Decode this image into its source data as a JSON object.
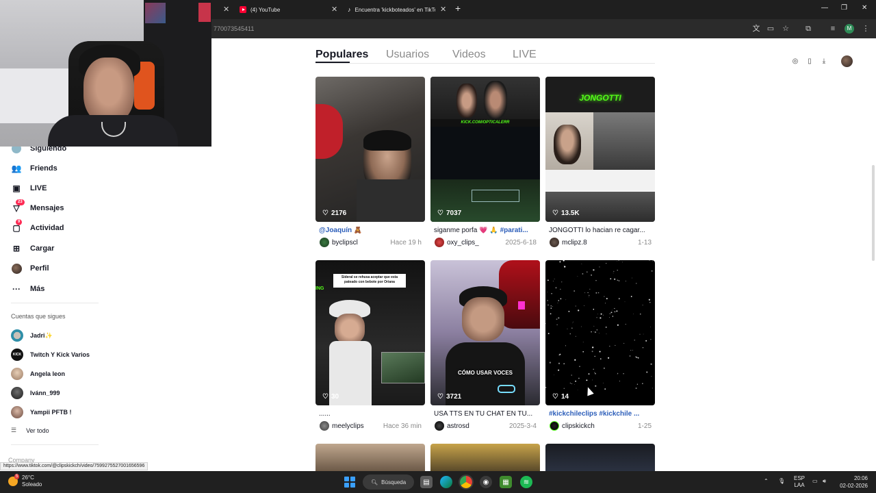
{
  "browser": {
    "tabs": [
      {
        "title": "(4) YouTube",
        "icon": "youtube-icon"
      },
      {
        "title": "Encuentra 'kickboteados' en TikTok",
        "icon": "tiktok-icon"
      }
    ],
    "url": "770073545411",
    "profile_initial": "M"
  },
  "search_tabs": [
    "Populares",
    "Usuarios",
    "Videos",
    "LIVE"
  ],
  "active_tab": "Populares",
  "sidebar": {
    "items": [
      {
        "label": "Siguiendo",
        "icon": "following-icon"
      },
      {
        "label": "Friends",
        "icon": "friends-icon"
      },
      {
        "label": "LIVE",
        "icon": "live-icon"
      },
      {
        "label": "Mensajes",
        "icon": "messages-icon",
        "badge": "23"
      },
      {
        "label": "Actividad",
        "icon": "activity-icon",
        "badge": "9"
      },
      {
        "label": "Cargar",
        "icon": "upload-icon"
      },
      {
        "label": "Perfil",
        "icon": "profile-icon"
      },
      {
        "label": "Más",
        "icon": "more-icon"
      }
    ],
    "following_header": "Cuentas que sigues",
    "following": [
      {
        "name": "Jadri✨"
      },
      {
        "name": "Twitch Y Kick Varios"
      },
      {
        "name": "Angela leon"
      },
      {
        "name": "Ivánn_999"
      },
      {
        "name": "Yampii PFTB !"
      }
    ],
    "see_all": "Ver todo",
    "company": "Company"
  },
  "videos": [
    {
      "likes": "2176",
      "caption_tag": "@Joaquín",
      "caption_text": " 🧸",
      "author": "byclipscl",
      "date": "Hace 19 h"
    },
    {
      "likes": "7037",
      "caption_text": "siganme porfa 💗 🙏 ",
      "caption_tag": "#parati...",
      "author": "oxy_clips_",
      "date": "2025-6-18"
    },
    {
      "likes": "13.5K",
      "caption_text": "JONGOTTI lo hacian re cagar...",
      "author": "mclipz.8",
      "date": "1-13"
    },
    {
      "likes": "30",
      "caption_text": "......",
      "author": "meelyclips",
      "date": "Hace 36 min"
    },
    {
      "likes": "3721",
      "caption_text": "USA TTS EN TU CHAT EN TU...",
      "author": "astrosd",
      "date": "2025-3-4"
    },
    {
      "likes": "14",
      "caption_tag": "#kickchileclips #kickchile ...",
      "author": "clipskickch",
      "date": "1-25"
    }
  ],
  "thumb_text": {
    "kick_banner": "KICK.COM/OPTICALERR",
    "jongotti": "JONGOTTI",
    "sideral": "Sideral se rehusa aceptar que esta pateado con bebote por Oriana",
    "voces": "CÓMO USAR VOCES"
  },
  "status_url": "https://www.tiktok.com/@clipskickch/video/7599275527001656596",
  "taskbar": {
    "weather_temp": "26°C",
    "weather_desc": "Soleado",
    "weather_badge": "5",
    "search_label": "Búsqueda",
    "lang_top": "ESP",
    "lang_bottom": "LAA",
    "time": "20:06",
    "date": "02-02-2026"
  },
  "colors": {
    "accent": "#fe2c55",
    "link": "#2b5db9",
    "tiktok_text": "#161823"
  }
}
